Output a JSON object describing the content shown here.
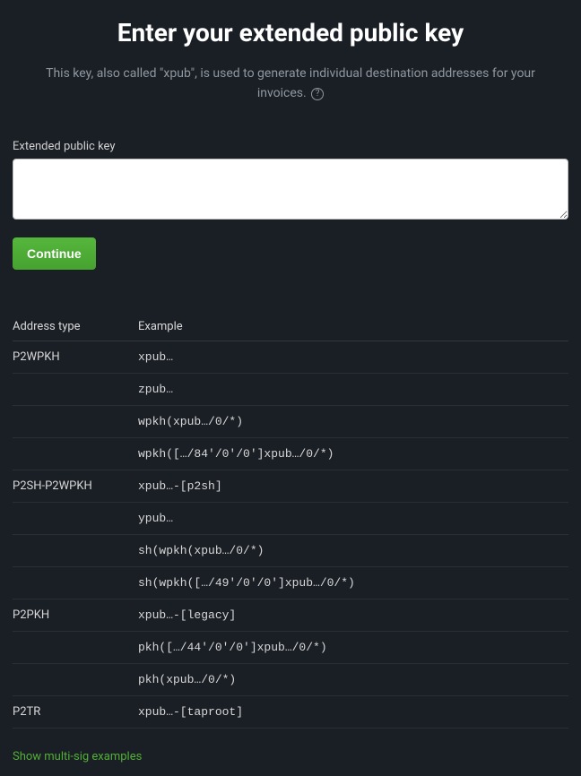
{
  "title": "Enter your extended public key",
  "subtitle": "This key, also called \"xpub\", is used to generate individual destination addresses for your invoices.",
  "field_label": "Extended public key",
  "continue_label": "Continue",
  "table": {
    "headers": {
      "type": "Address type",
      "example": "Example"
    },
    "groups": [
      {
        "type": "P2WPKH",
        "examples": [
          "xpub…",
          "zpub…",
          "wpkh(xpub…/0/*)",
          "wpkh([…/84'/0'/0']xpub…/0/*)"
        ]
      },
      {
        "type": "P2SH-P2WPKH",
        "examples": [
          "xpub…-[p2sh]",
          "ypub…",
          "sh(wpkh(xpub…/0/*)",
          "sh(wpkh([…/49'/0'/0']xpub…/0/*)"
        ]
      },
      {
        "type": "P2PKH",
        "examples": [
          "xpub…-[legacy]",
          "pkh([…/44'/0'/0']xpub…/0/*)",
          "pkh(xpub…/0/*)"
        ]
      },
      {
        "type": "P2TR",
        "examples": [
          "xpub…-[taproot]"
        ]
      }
    ]
  },
  "multisig_link": "Show multi-sig examples"
}
